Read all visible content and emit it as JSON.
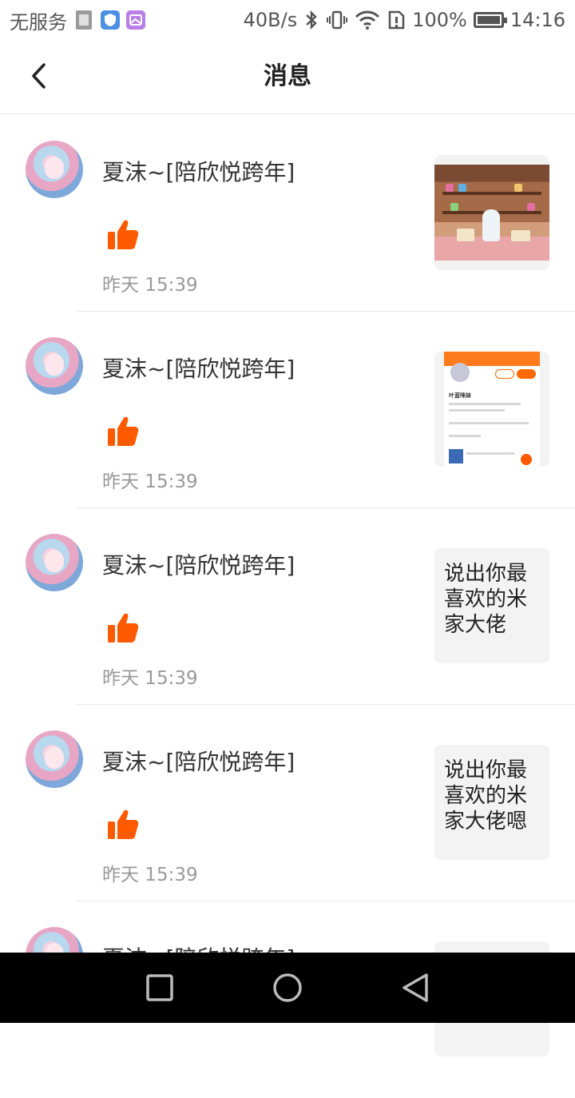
{
  "status_bar": {
    "carrier": "无服务",
    "speed": "40B/s",
    "battery": "100%",
    "time": "14:16"
  },
  "header": {
    "title": "消息",
    "back_icon": "chevron-left-icon"
  },
  "colors": {
    "accent": "#ff5a00",
    "time_text": "#999999",
    "divider": "#ebebeb",
    "nav_bg": "#000000"
  },
  "messages": [
    {
      "username": "夏沫~[陪欣悦跨年]",
      "icon": "thumbs-up-icon",
      "time": "昨天 15:39",
      "preview_type": "image",
      "preview_text": ""
    },
    {
      "username": "夏沫~[陪欣悦跨年]",
      "icon": "thumbs-up-icon",
      "time": "昨天 15:39",
      "preview_type": "image",
      "preview_text": "",
      "profile_name": "叶蓝咪妹"
    },
    {
      "username": "夏沫~[陪欣悦跨年]",
      "icon": "thumbs-up-icon",
      "time": "昨天 15:39",
      "preview_type": "text",
      "preview_text": "说出你最喜欢的米家大佬"
    },
    {
      "username": "夏沫~[陪欣悦跨年]",
      "icon": "thumbs-up-icon",
      "time": "昨天 15:39",
      "preview_type": "text",
      "preview_text": "说出你最喜欢的米家大佬嗯"
    },
    {
      "username": "夏沫~[陪欣悦跨年]",
      "icon": "thumbs-up-icon",
      "time": "",
      "preview_type": "text",
      "preview_text": ""
    }
  ],
  "nav": {
    "recent_icon": "square-icon",
    "home_icon": "circle-icon",
    "back_icon": "triangle-back-icon"
  }
}
